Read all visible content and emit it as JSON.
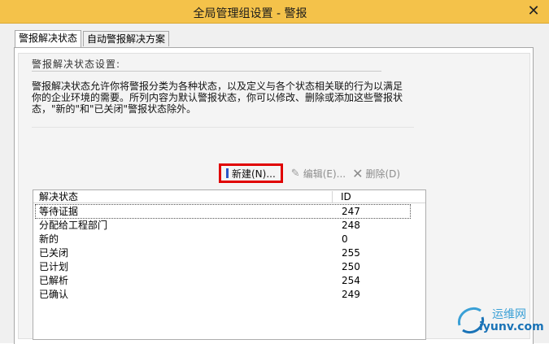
{
  "window": {
    "title": "全局管理组设置 - 警报",
    "close_glyph": "✕"
  },
  "tabs": [
    {
      "label": "警报解决状态",
      "active": true
    },
    {
      "label": "自动警报解决方案",
      "active": false
    }
  ],
  "section": {
    "title": "警报解决状态设置:",
    "description": "警报解决状态允许你将警报分类为各种状态，以及定义与各个状态相关联的行为以满足你的企业环境的需要。所列内容为默认警报状态，你可以修改、删除或添加这些警报状态，\"新的\"和\"已关闭\"警报状态除外。"
  },
  "toolbar": {
    "new_label": "新建(N)...",
    "edit_label": "编辑(E)...",
    "delete_label": "删除(D)"
  },
  "list": {
    "columns": {
      "name": "解决状态",
      "id": "ID"
    },
    "rows": [
      {
        "name": "等待证据",
        "id": "247"
      },
      {
        "name": "分配给工程部门",
        "id": "248"
      },
      {
        "name": "新的",
        "id": "0"
      },
      {
        "name": "已关闭",
        "id": "255"
      },
      {
        "name": "已计划",
        "id": "250"
      },
      {
        "name": "已解析",
        "id": "254"
      },
      {
        "name": "已确认",
        "id": "249"
      }
    ]
  },
  "watermark": {
    "line1": "运维网",
    "line2": "iyunv.com"
  },
  "colors": {
    "titlebar": "#f4c24a",
    "highlight_box": "#e00000",
    "new_icon": "#2a55c7"
  }
}
